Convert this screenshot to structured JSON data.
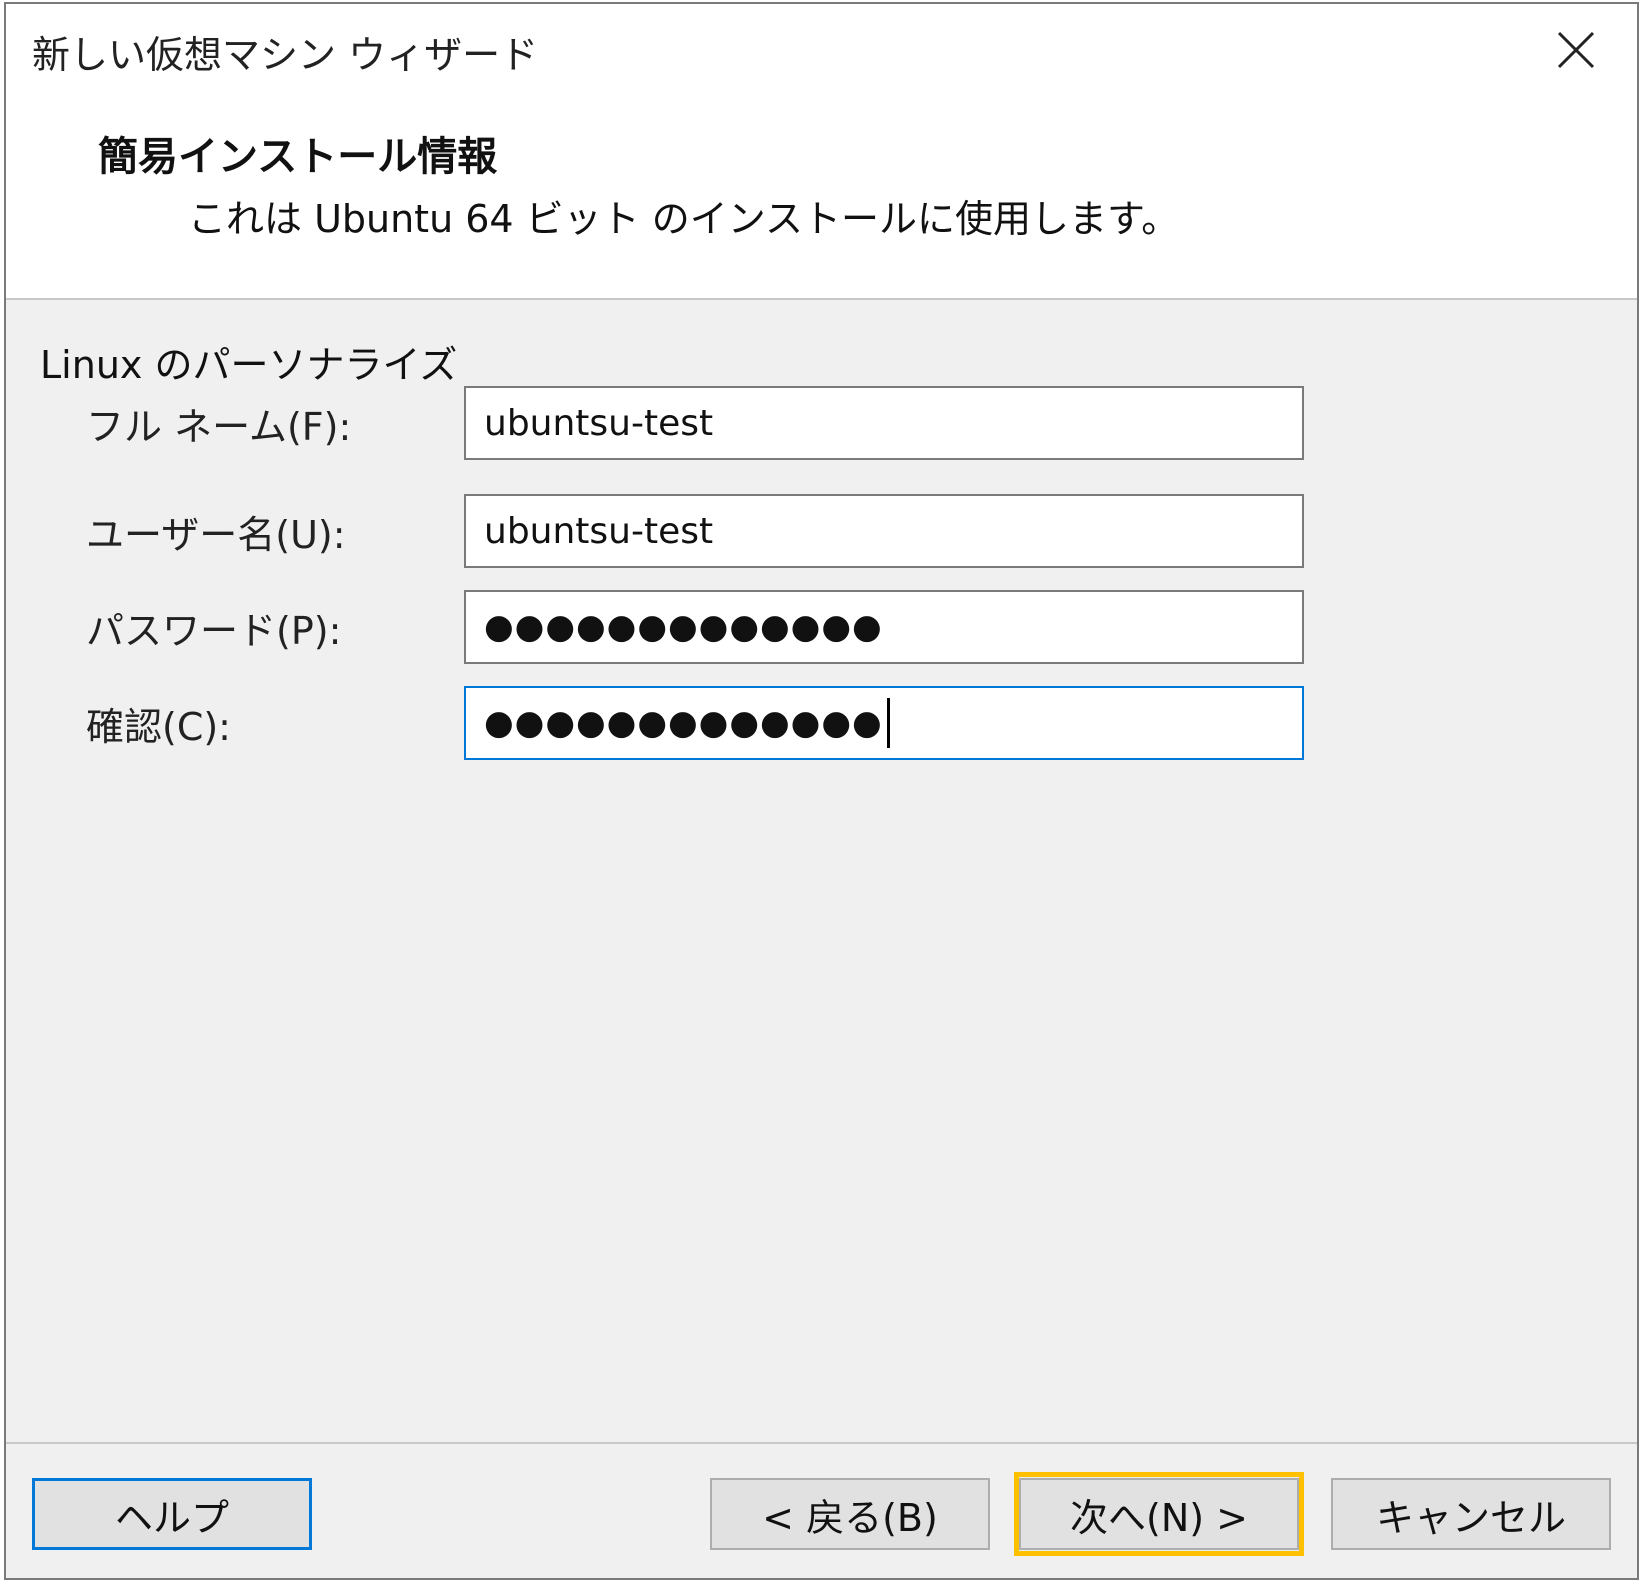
{
  "window": {
    "title": "新しい仮想マシン ウィザード"
  },
  "header": {
    "heading": "簡易インストール情報",
    "subheading": "これは Ubuntu 64 ビット のインストールに使用します。"
  },
  "form": {
    "group_label": "Linux のパーソナライズ",
    "full_name": {
      "label": "フル ネーム(F):",
      "value": "ubuntsu-test"
    },
    "user_name": {
      "label": "ユーザー名(U):",
      "value": "ubuntsu-test"
    },
    "password": {
      "label": "パスワード(P):",
      "masked_value": "●●●●●●●●●●●●●"
    },
    "confirm": {
      "label": "確認(C):",
      "masked_value": "●●●●●●●●●●●●●"
    }
  },
  "buttons": {
    "help": "ヘルプ",
    "back": "< 戻る(B)",
    "next": "次へ(N) >",
    "cancel": "キャンセル"
  },
  "colors": {
    "focus_border": "#0078d7",
    "highlight": "#ffc000"
  },
  "icons": {
    "close": "close-icon"
  }
}
